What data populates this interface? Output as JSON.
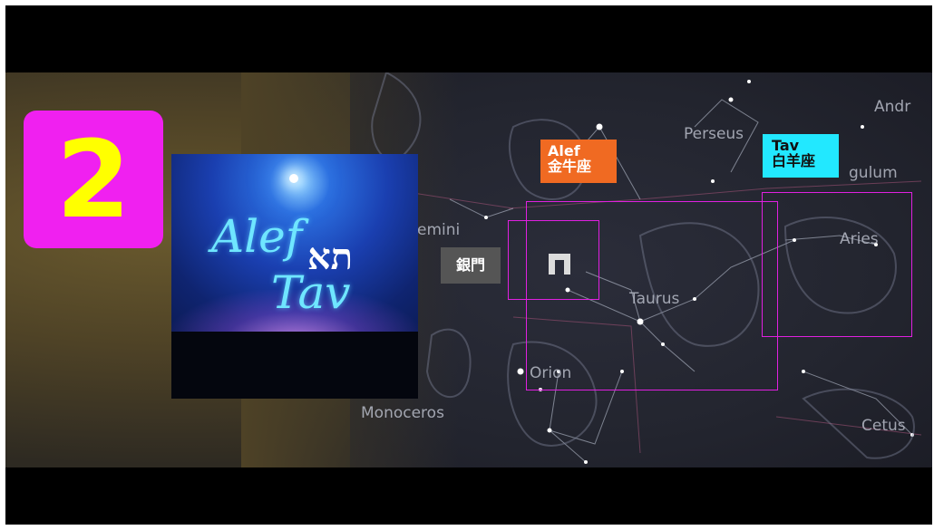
{
  "badge": {
    "number": "2",
    "bg_color": "#f020f0",
    "text_color": "#ffff00"
  },
  "album": {
    "line1": "Alef",
    "line2": "Tav",
    "hebrew": "תא"
  },
  "tags": {
    "alef": {
      "line1": "Alef",
      "line2": "金牛座",
      "color": "#f06a22"
    },
    "tav": {
      "line1": "Tav",
      "line2": "白羊座",
      "color": "#22e8ff"
    }
  },
  "gate_label": "銀門",
  "gate_symbol_icon": "gate-pi-icon",
  "constellations": [
    "Andr",
    "Perseus",
    "gulum",
    "emini",
    "Aries",
    "Taurus",
    "Orion",
    "Monoceros",
    "Cetus"
  ],
  "highlight_color": "#e020e0"
}
